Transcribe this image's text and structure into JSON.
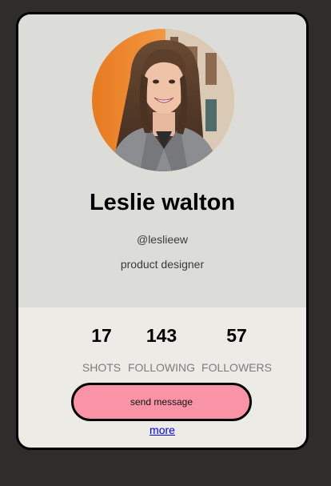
{
  "profile": {
    "name": "Leslie walton",
    "handle": "@leslieew",
    "role": "product designer"
  },
  "stats": [
    {
      "value": "17",
      "label": "SHOTS"
    },
    {
      "value": "143",
      "label": "FOLLOWING"
    },
    {
      "value": "57",
      "label": "FOLLOWERS"
    }
  ],
  "actions": {
    "send_label": "send message",
    "more_label": "more"
  },
  "colors": {
    "page_bg": "#2f2c2c",
    "card_top_bg": "#dcddd9",
    "card_bottom_bg": "#edebe5",
    "button_bg": "#f993a6",
    "link": "#0000ee"
  },
  "icons": {
    "avatar": "profile-photo"
  }
}
